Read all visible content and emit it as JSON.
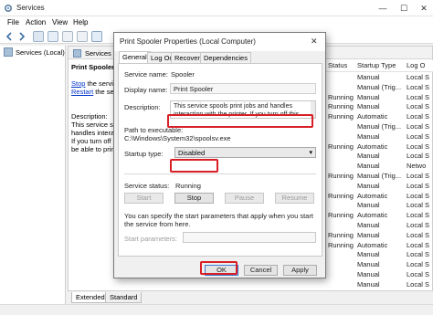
{
  "window": {
    "title": "Services",
    "menu": [
      "File",
      "Action",
      "View",
      "Help"
    ]
  },
  "tree": {
    "root": "Services (Local)"
  },
  "pane": {
    "header": "Services (Lo",
    "service_name": "Print Spooler",
    "stop_link": "Stop",
    "stop_suffix": " the servic",
    "restart_link": "Restart",
    "restart_suffix": " the servi",
    "desc_lines": [
      "Description:",
      "This service spool",
      "handles interact",
      "If you turn off th",
      "be able to print"
    ]
  },
  "columns": {
    "status": "Status",
    "startup": "Startup Type",
    "logon": "Log O"
  },
  "rows": [
    {
      "status": "",
      "startup": "Manual",
      "logon": "Local S"
    },
    {
      "status": "",
      "startup": "Manual (Trig...",
      "logon": "Local S"
    },
    {
      "status": "Running",
      "startup": "Manual",
      "logon": "Local S"
    },
    {
      "status": "Running",
      "startup": "Manual",
      "logon": "Local S"
    },
    {
      "status": "Running",
      "startup": "Automatic",
      "logon": "Local S"
    },
    {
      "status": "",
      "startup": "Manual (Trig...",
      "logon": "Local S"
    },
    {
      "status": "",
      "startup": "Manual",
      "logon": "Local S"
    },
    {
      "status": "Running",
      "startup": "Automatic",
      "logon": "Local S"
    },
    {
      "status": "",
      "startup": "Manual",
      "logon": "Local S"
    },
    {
      "status": "",
      "startup": "Manual",
      "logon": "Netwo"
    },
    {
      "status": "Running",
      "startup": "Manual (Trig...",
      "logon": "Local S"
    },
    {
      "status": "",
      "startup": "Manual",
      "logon": "Local S"
    },
    {
      "status": "Running",
      "startup": "Automatic",
      "logon": "Local S"
    },
    {
      "status": "",
      "startup": "Manual",
      "logon": "Local S"
    },
    {
      "status": "Running",
      "startup": "Automatic",
      "logon": "Local S"
    },
    {
      "status": "",
      "startup": "Manual",
      "logon": "Local S"
    },
    {
      "status": "Running",
      "startup": "Manual",
      "logon": "Local S"
    },
    {
      "status": "Running",
      "startup": "Automatic",
      "logon": "Local S"
    },
    {
      "status": "",
      "startup": "Manual",
      "logon": "Local S"
    },
    {
      "status": "",
      "startup": "Manual",
      "logon": "Local S"
    },
    {
      "status": "",
      "startup": "Manual",
      "logon": "Local S"
    },
    {
      "status": "",
      "startup": "Manual",
      "logon": "Local S"
    }
  ],
  "bottom_tabs": [
    "Extended",
    "Standard"
  ],
  "dialog": {
    "title": "Print Spooler Properties (Local Computer)",
    "tabs": [
      "General",
      "Log On",
      "Recovery",
      "Dependencies"
    ],
    "service_name_label": "Service name:",
    "service_name": "Spooler",
    "display_name_label": "Display name:",
    "display_name": "Print Spooler",
    "description_label": "Description:",
    "description": "This service spools print jobs and handles interaction with the printer. If you turn off this service, you won't be",
    "path_label": "Path to executable:",
    "path": "C:\\Windows\\System32\\spoolsv.exe",
    "startup_type_label": "Startup type:",
    "startup_type": "Disabled",
    "status_label": "Service status:",
    "status": "Running",
    "buttons": {
      "start": "Start",
      "stop": "Stop",
      "pause": "Pause",
      "resume": "Resume"
    },
    "help_text": "You can specify the start parameters that apply when you start the service from here.",
    "start_params_label": "Start parameters:",
    "ok": "OK",
    "cancel": "Cancel",
    "apply": "Apply"
  }
}
